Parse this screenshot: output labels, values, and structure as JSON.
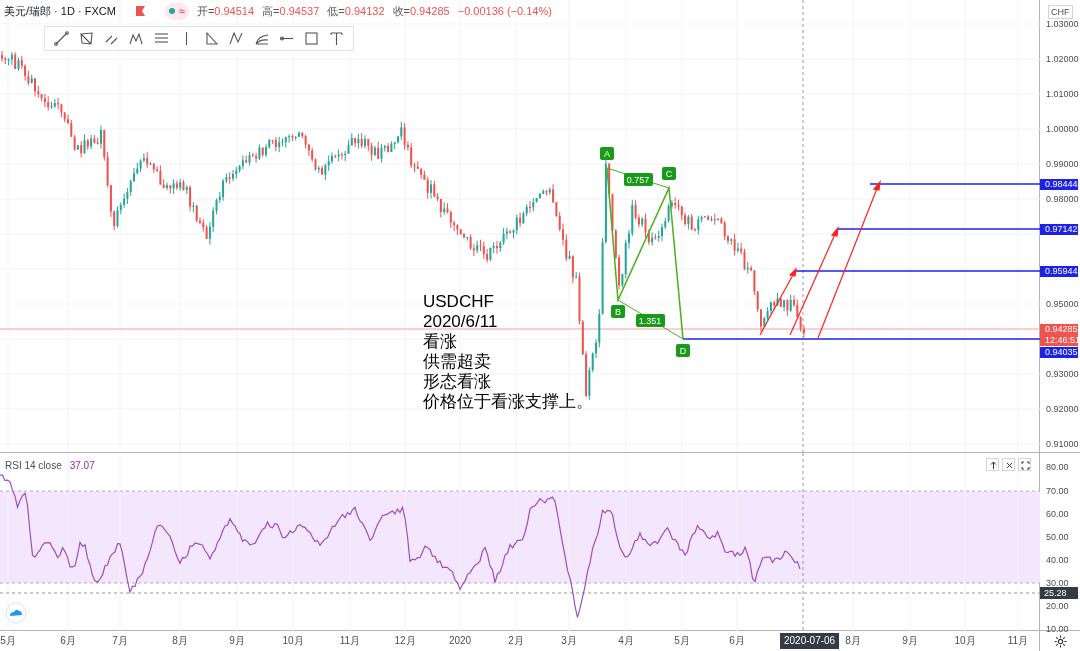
{
  "legend": {
    "symbol": "美元/瑞郎 · 1D · FXCM",
    "indicator": "≈",
    "ohlc": [
      {
        "label": "开=",
        "value": "0.94514"
      },
      {
        "label": "高=",
        "value": "0.94537"
      },
      {
        "label": "低=",
        "value": "0.94132"
      },
      {
        "label": "收=",
        "value": "0.94285"
      }
    ],
    "change": "−0.00136 (−0.14%)"
  },
  "annotation": [
    "USDCHF",
    "2020/6/11",
    "看涨",
    "供需超卖",
    "形态看涨",
    "价格位于看涨支撑上。"
  ],
  "pattern": {
    "points": [
      "A",
      "B",
      "C",
      "D"
    ],
    "ratios": [
      "0.757",
      "1.351"
    ]
  },
  "price_axis": {
    "currency": "CHF",
    "ticks": [
      "1.03000",
      "1.02000",
      "1.01000",
      "1.00000",
      "0.99000",
      "0.98000",
      "0.95000",
      "0.93000",
      "0.92000",
      "0.91000"
    ],
    "tags": [
      {
        "kind": "level",
        "value": "0.98444"
      },
      {
        "kind": "level",
        "value": "0.97142"
      },
      {
        "kind": "level",
        "value": "0.95944"
      },
      {
        "kind": "last",
        "value": "0.94285"
      },
      {
        "kind": "countdown",
        "value": "12:46:51"
      },
      {
        "kind": "level",
        "value": "0.94035"
      }
    ]
  },
  "rsi": {
    "title": "RSI 14 close",
    "value": "37.07",
    "ticks": [
      "80.00",
      "70.00",
      "60.00",
      "50.00",
      "40.00",
      "30.00",
      "20.00",
      "10.00"
    ],
    "crosshair_value": "25.28"
  },
  "time_axis": {
    "labels": [
      "5月",
      "6月",
      "7月",
      "8月",
      "9月",
      "10月",
      "11月",
      "12月",
      "2020",
      "2月",
      "3月",
      "4月",
      "5月",
      "6月",
      "8月",
      "9月",
      "10月",
      "11月"
    ],
    "crosshair_date": "2020-07-06"
  }
}
